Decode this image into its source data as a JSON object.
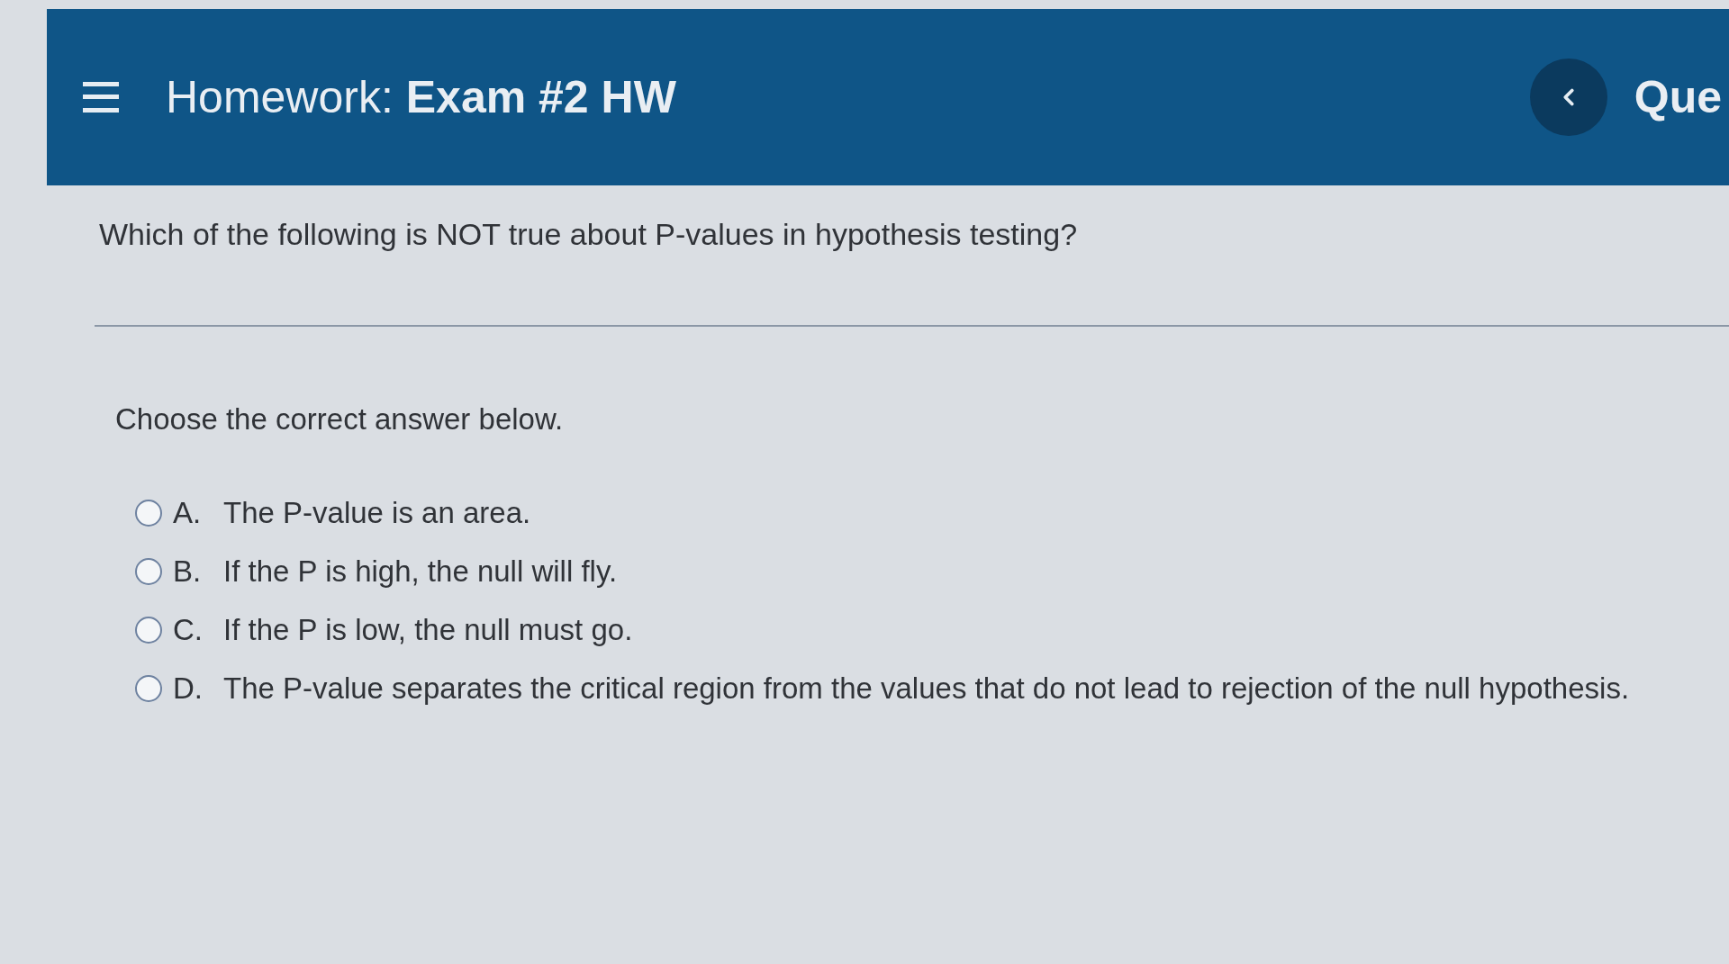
{
  "header": {
    "title": "Homework: **Exam #2 HW**",
    "question_nav_label": "Que"
  },
  "question": {
    "prompt": "Which of the following is NOT true about P-values in hypothesis testing?",
    "instruction": "Choose the correct answer below.",
    "options": [
      {
        "letter": "A.",
        "text": "The P-value is an area.",
        "selected": false
      },
      {
        "letter": "B.",
        "text": "If the P is high, the null will fly.",
        "selected": false
      },
      {
        "letter": "C.",
        "text": "If the P is low, the null must go.",
        "selected": false
      },
      {
        "letter": "D.",
        "text": "The P-value separates the critical region from the values that do not lead to rejection of the null hypothesis.",
        "selected": false
      }
    ]
  }
}
